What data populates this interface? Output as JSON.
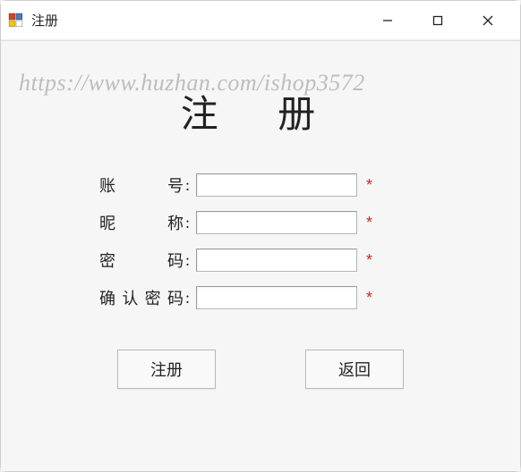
{
  "titlebar": {
    "title": "注册"
  },
  "watermark": "https://www.huzhan.com/ishop3572",
  "heading": "注 册",
  "form": {
    "username": {
      "label": "账号",
      "value": "",
      "required": "*"
    },
    "nickname": {
      "label": "昵称",
      "value": "",
      "required": "*"
    },
    "password": {
      "label": "密码",
      "value": "",
      "required": "*"
    },
    "confirm": {
      "label": "确认密码",
      "value": "",
      "required": "*"
    },
    "colon": ":"
  },
  "buttons": {
    "register": "注册",
    "back": "返回"
  }
}
